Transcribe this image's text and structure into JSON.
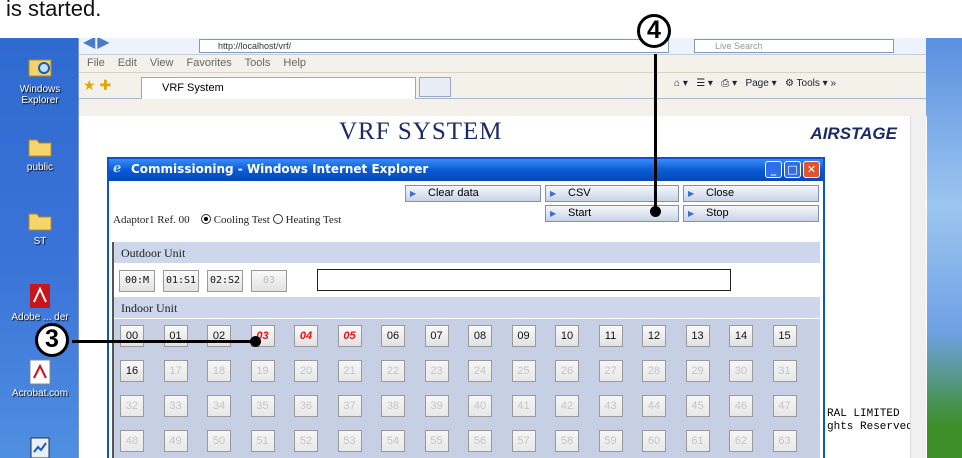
{
  "caption": "is started.",
  "desktop": {
    "icons": [
      {
        "label": "Windows Explorer",
        "icon": "windows-explorer-icon"
      },
      {
        "label": "public",
        "icon": "folder-icon"
      },
      {
        "label": "ST",
        "icon": "folder-icon"
      },
      {
        "label": "Adobe ... der",
        "icon": "adobe-reader-icon"
      },
      {
        "label": "Acrobat.com",
        "icon": "acrobat-icon"
      },
      {
        "label": "",
        "icon": "app-icon"
      }
    ]
  },
  "browser": {
    "address": "http://localhost/vrf/",
    "search_placeholder": "Live Search",
    "menu": [
      "File",
      "Edit",
      "View",
      "Favorites",
      "Tools",
      "Help"
    ],
    "tab_label": "VRF System",
    "toolbar": {
      "page": "Page",
      "tools": "Tools"
    },
    "page_title": "VRF SYSTEM",
    "brand": "AIRSTAGE",
    "footer_line1": "RAL LIMITED",
    "footer_line2": "ghts Reserved."
  },
  "popup": {
    "title": "Commissioning - Windows Internet Explorer",
    "buttons": {
      "clear_data": "Clear data",
      "csv": "CSV",
      "close": "Close",
      "start": "Start",
      "stop": "Stop"
    },
    "adaptor_label": "Adaptor1",
    "ref_label": "Ref. 00",
    "cooling_label": "Cooling Test",
    "heating_label": "Heating Test",
    "selected_mode": "cooling",
    "outdoor_head": "Outdoor Unit",
    "outdoor_units": [
      {
        "label": "00:M",
        "enabled": true
      },
      {
        "label": "01:S1",
        "enabled": true
      },
      {
        "label": "02:S2",
        "enabled": true
      },
      {
        "label": "03",
        "enabled": false
      }
    ],
    "indoor_head": "Indoor Unit",
    "indoor_units": [
      {
        "label": "00",
        "state": "on"
      },
      {
        "label": "01",
        "state": "on"
      },
      {
        "label": "02",
        "state": "on"
      },
      {
        "label": "03",
        "state": "active"
      },
      {
        "label": "04",
        "state": "active"
      },
      {
        "label": "05",
        "state": "active"
      },
      {
        "label": "06",
        "state": "on"
      },
      {
        "label": "07",
        "state": "on"
      },
      {
        "label": "08",
        "state": "on"
      },
      {
        "label": "09",
        "state": "on"
      },
      {
        "label": "10",
        "state": "on"
      },
      {
        "label": "11",
        "state": "on"
      },
      {
        "label": "12",
        "state": "on"
      },
      {
        "label": "13",
        "state": "on"
      },
      {
        "label": "14",
        "state": "on"
      },
      {
        "label": "15",
        "state": "on"
      },
      {
        "label": "16",
        "state": "on"
      },
      {
        "label": "17",
        "state": "off"
      },
      {
        "label": "18",
        "state": "off"
      },
      {
        "label": "19",
        "state": "off"
      },
      {
        "label": "20",
        "state": "off"
      },
      {
        "label": "21",
        "state": "off"
      },
      {
        "label": "22",
        "state": "off"
      },
      {
        "label": "23",
        "state": "off"
      },
      {
        "label": "24",
        "state": "off"
      },
      {
        "label": "25",
        "state": "off"
      },
      {
        "label": "26",
        "state": "off"
      },
      {
        "label": "27",
        "state": "off"
      },
      {
        "label": "28",
        "state": "off"
      },
      {
        "label": "29",
        "state": "off"
      },
      {
        "label": "30",
        "state": "off"
      },
      {
        "label": "31",
        "state": "off"
      },
      {
        "label": "32",
        "state": "off"
      },
      {
        "label": "33",
        "state": "off"
      },
      {
        "label": "34",
        "state": "off"
      },
      {
        "label": "35",
        "state": "off"
      },
      {
        "label": "36",
        "state": "off"
      },
      {
        "label": "37",
        "state": "off"
      },
      {
        "label": "38",
        "state": "off"
      },
      {
        "label": "39",
        "state": "off"
      },
      {
        "label": "40",
        "state": "off"
      },
      {
        "label": "41",
        "state": "off"
      },
      {
        "label": "42",
        "state": "off"
      },
      {
        "label": "43",
        "state": "off"
      },
      {
        "label": "44",
        "state": "off"
      },
      {
        "label": "45",
        "state": "off"
      },
      {
        "label": "46",
        "state": "off"
      },
      {
        "label": "47",
        "state": "off"
      },
      {
        "label": "48",
        "state": "off"
      },
      {
        "label": "49",
        "state": "off"
      },
      {
        "label": "50",
        "state": "off"
      },
      {
        "label": "51",
        "state": "off"
      },
      {
        "label": "52",
        "state": "off"
      },
      {
        "label": "53",
        "state": "off"
      },
      {
        "label": "54",
        "state": "off"
      },
      {
        "label": "55",
        "state": "off"
      },
      {
        "label": "56",
        "state": "off"
      },
      {
        "label": "57",
        "state": "off"
      },
      {
        "label": "58",
        "state": "off"
      },
      {
        "label": "59",
        "state": "off"
      },
      {
        "label": "60",
        "state": "off"
      },
      {
        "label": "61",
        "state": "off"
      },
      {
        "label": "62",
        "state": "off"
      },
      {
        "label": "63",
        "state": "off"
      }
    ]
  },
  "annotations": {
    "callout_3": "3",
    "callout_4": "4"
  },
  "colors": {
    "active_unit": "#e11111",
    "title_bar": "#0a5bd6",
    "section_header": "#cdd6ea"
  }
}
